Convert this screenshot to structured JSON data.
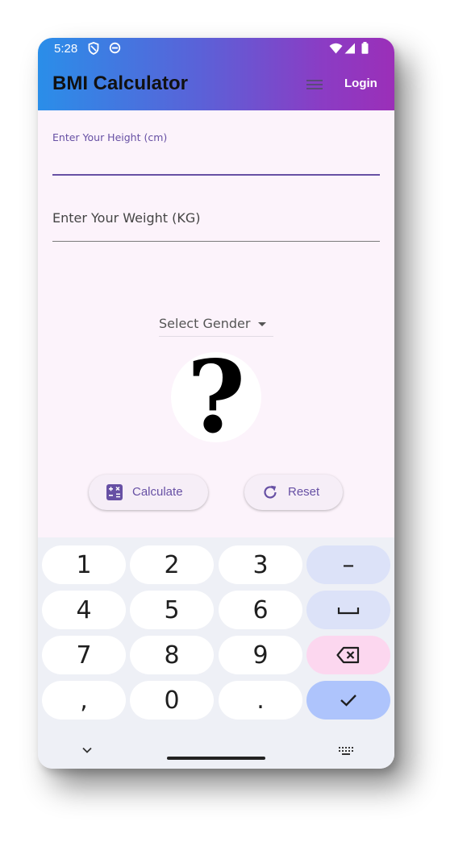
{
  "status_bar": {
    "time": "5:28"
  },
  "app_bar": {
    "title": "BMI Calculator",
    "login_label": "Login"
  },
  "form": {
    "height_label": "Enter Your Height (cm)",
    "weight_placeholder": "Enter Your Weight (KG)",
    "gender_label": "Select Gender",
    "avatar_glyph": "?"
  },
  "buttons": {
    "calculate_label": "Calculate",
    "reset_label": "Reset"
  },
  "keyboard": {
    "keys": [
      [
        "1",
        "2",
        "3",
        "–"
      ],
      [
        "4",
        "5",
        "6",
        "space"
      ],
      [
        "7",
        "8",
        "9",
        "backspace"
      ],
      [
        ",",
        "0",
        ".",
        "done"
      ]
    ]
  },
  "icons": [
    "shield-icon",
    "sync-icon",
    "wifi-icon",
    "signal-icon",
    "battery-icon",
    "menu-icon",
    "calculator-icon",
    "refresh-icon",
    "chevron-down-icon",
    "keyboard-icon"
  ],
  "colors": {
    "accent": "#6750a4",
    "appbar_start": "#2a8ee9",
    "appbar_end": "#9b2fb8",
    "background": "#fcf3fb"
  }
}
